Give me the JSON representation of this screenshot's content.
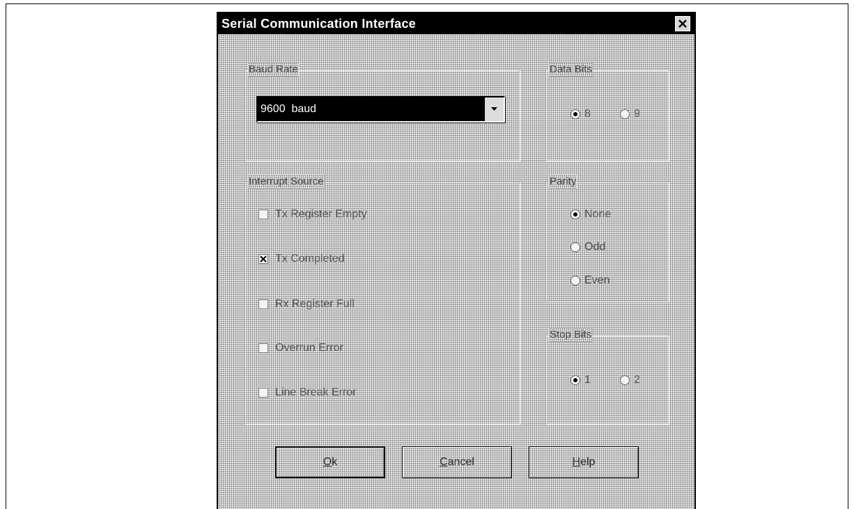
{
  "dialog": {
    "title": "Serial Communication Interface",
    "close_icon": "close-icon"
  },
  "baud_rate": {
    "legend": "Baud Rate",
    "selected": "9600  baud"
  },
  "data_bits": {
    "legend": "Data Bits",
    "options": [
      "8",
      "9"
    ],
    "selected": "8"
  },
  "interrupt_source": {
    "legend": "Interrupt Source",
    "items": [
      {
        "label": "Tx Register Empty",
        "checked": false
      },
      {
        "label": "Tx Completed",
        "checked": true
      },
      {
        "label": "Rx Register Full",
        "checked": false
      },
      {
        "label": "Overrun Error",
        "checked": false
      },
      {
        "label": "Line Break Error",
        "checked": false
      }
    ]
  },
  "parity": {
    "legend": "Parity",
    "options": [
      "None",
      "Odd",
      "Even"
    ],
    "selected": "None"
  },
  "stop_bits": {
    "legend": "Stop Bits",
    "options": [
      "1",
      "2"
    ],
    "selected": "1"
  },
  "buttons": {
    "ok": {
      "mnemonic": "O",
      "rest": "k"
    },
    "cancel": {
      "mnemonic": "C",
      "rest": "ancel"
    },
    "help": {
      "mnemonic": "H",
      "rest": "elp"
    }
  },
  "colors": {
    "titlebar": "#000000",
    "dialog_dither": "#7a7a7a",
    "selection": "#000000"
  }
}
